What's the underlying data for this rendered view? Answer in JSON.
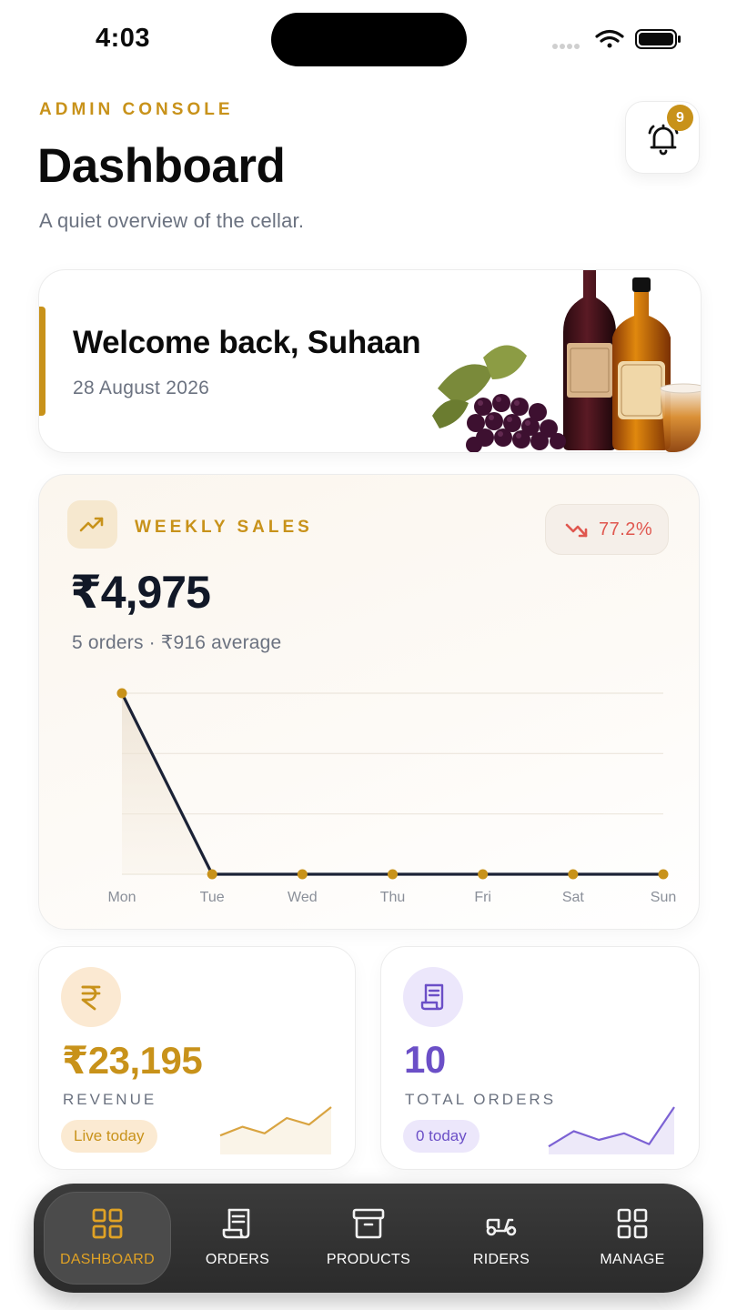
{
  "status_bar": {
    "time": "4:03"
  },
  "header": {
    "eyebrow": "ADMIN CONSOLE",
    "title": "Dashboard",
    "subtitle": "A quiet overview of the cellar.",
    "notification_count": "9"
  },
  "welcome": {
    "title": "Welcome back, Suhaan",
    "date": "28 August 2026"
  },
  "weekly_sales": {
    "label": "WEEKLY SALES",
    "change": "77.2%",
    "change_direction": "down",
    "total": "₹4,975",
    "meta": "5 orders · ₹916 average"
  },
  "chart_data": {
    "type": "line",
    "categories": [
      "Mon",
      "Tue",
      "Wed",
      "Thu",
      "Fri",
      "Sat",
      "Sun"
    ],
    "values": [
      4975,
      0,
      0,
      0,
      0,
      0,
      0
    ],
    "ylim": [
      0,
      4975
    ],
    "grid": true
  },
  "stats": {
    "revenue": {
      "value": "₹23,195",
      "label": "REVENUE",
      "pill": "Live today",
      "sparkline": [
        0.35,
        0.55,
        0.4,
        0.75,
        0.6,
        1.0
      ]
    },
    "orders": {
      "value": "10",
      "label": "TOTAL ORDERS",
      "pill": "0 today",
      "sparkline": [
        0.1,
        0.45,
        0.25,
        0.4,
        0.15,
        1.0
      ]
    }
  },
  "nav": {
    "items": [
      {
        "label": "DASHBOARD",
        "icon": "grid-icon",
        "active": true
      },
      {
        "label": "ORDERS",
        "icon": "receipt-icon",
        "active": false
      },
      {
        "label": "PRODUCTS",
        "icon": "archive-box-icon",
        "active": false
      },
      {
        "label": "RIDERS",
        "icon": "scooter-icon",
        "active": false
      },
      {
        "label": "MANAGE",
        "icon": "grid-icon",
        "active": false
      }
    ]
  },
  "colors": {
    "accent": "#C8921A",
    "negative": "#E0574F",
    "orders_accent": "#6B4FC7",
    "chart_line": "#1B2236"
  }
}
